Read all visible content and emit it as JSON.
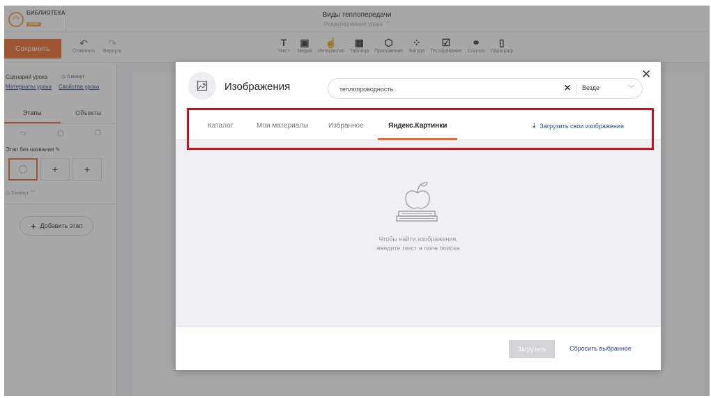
{
  "app": {
    "logo_text": "БИБЛИОТЕКА",
    "logo_badge": "МЭШ",
    "doc_title": "Виды теплопередачи",
    "doc_subtitle": "Редактирование урока",
    "save_label": "Сохранить",
    "undo_label": "Отменить",
    "redo_label": "Вернуть",
    "tools": [
      {
        "label": "Текст",
        "glyph": "T",
        "icon": "text-icon"
      },
      {
        "label": "Медиа",
        "glyph": "▣",
        "icon": "media-icon"
      },
      {
        "label": "Интерактив",
        "glyph": "☝",
        "icon": "interactive-icon"
      },
      {
        "label": "Таблица",
        "glyph": "▦",
        "icon": "table-icon"
      },
      {
        "label": "Приложение",
        "glyph": "⬡",
        "icon": "app-icon"
      },
      {
        "label": "Фигура",
        "glyph": "⁘",
        "icon": "shape-icon"
      },
      {
        "label": "Тестирование",
        "glyph": "☑",
        "icon": "test-icon"
      },
      {
        "label": "Ссылка",
        "glyph": "⚭",
        "icon": "link-icon"
      },
      {
        "label": "Параграф",
        "glyph": "▯",
        "icon": "paragraph-icon"
      }
    ]
  },
  "sidebar": {
    "scenario_label": "Сценарий урока",
    "time_label": "5 минут",
    "link_materials": "Материалы урока",
    "link_properties": "Свойства урока",
    "tab_stages": "Этапы",
    "tab_objects": "Объекты",
    "stage_name": "Этап без названия",
    "stage_time": "5 минут",
    "add_stage": "Добавить этап"
  },
  "modal": {
    "title": "Изображения",
    "search_value": "теплопроводность",
    "scope": "Везде",
    "tabs": [
      "Каталог",
      "Мои материалы",
      "Избранное",
      "Яндекс.Картинки"
    ],
    "active_tab": "Яндекс.Картинки",
    "upload_own": "Загрузить свои изображения",
    "empty_line1": "Чтобы найти изображения,",
    "empty_line2": "введите текст в поле поиска",
    "load_button": "Загрузить",
    "reset_link": "Сбросить выбранное"
  },
  "colors": {
    "accent": "#ee6a2b",
    "highlight": "#c8141e",
    "link": "#2a4b8d"
  }
}
